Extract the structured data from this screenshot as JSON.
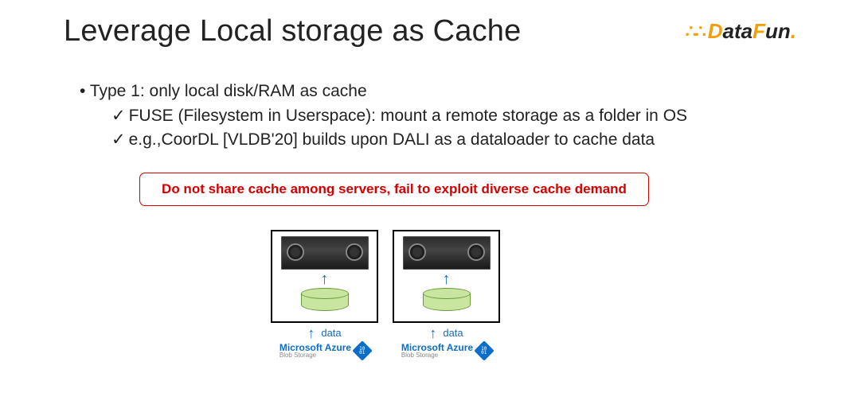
{
  "logo": {
    "brand": "DataFun",
    "parts": {
      "d": "D",
      "ata": "ata",
      "f": "F",
      "un": "un",
      "dot": "."
    }
  },
  "title": "Leverage Local storage as Cache",
  "bullet": "Type 1: only local disk/RAM as cache",
  "sub_items": [
    "FUSE (Filesystem in Userspace): mount a remote storage as a folder in OS",
    "e.g.,CoorDL [VLDB'20] builds upon DALI as a dataloader to cache data"
  ],
  "callout": "Do not share cache among servers, fail to exploit diverse cache demand",
  "diagram": {
    "data_label": "data",
    "azure_name": "Microsoft Azure",
    "azure_sub": "Blob Storage",
    "azure_bits": "10\n01"
  }
}
